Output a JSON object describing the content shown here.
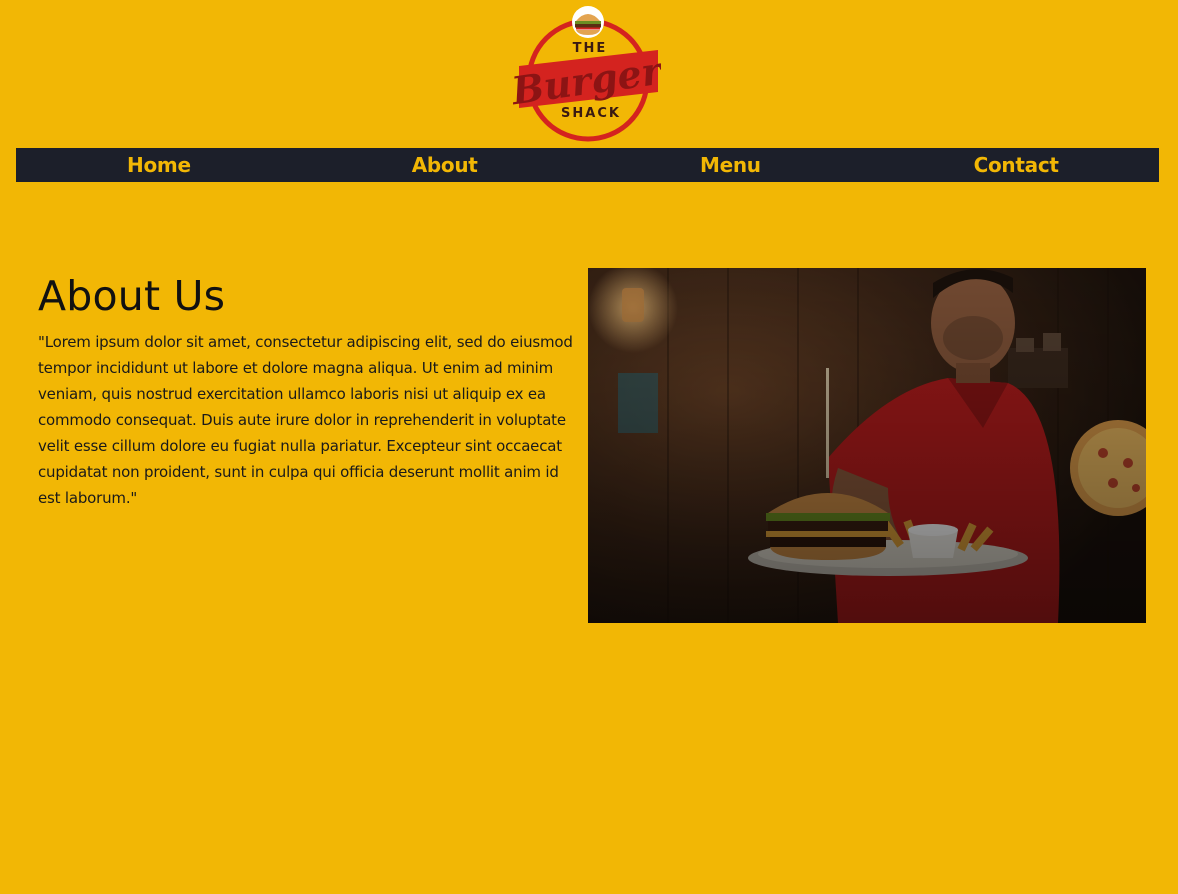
{
  "logo": {
    "line1": "THE",
    "line2": "Burger",
    "line3": "SHACK",
    "colors": {
      "ring": "#d4231f",
      "fill": "#f2b705",
      "text": "#3a1a12"
    }
  },
  "nav": {
    "items": [
      {
        "label": "Home"
      },
      {
        "label": "About"
      },
      {
        "label": "Menu"
      },
      {
        "label": "Contact"
      }
    ],
    "colors": {
      "background": "#1c1f2a",
      "text": "#f2b705"
    }
  },
  "about": {
    "heading": "About Us",
    "body": "\"Lorem ipsum dolor sit amet, consectetur adipiscing elit, sed do eiusmod tempor incididunt ut labore et dolore magna aliqua. Ut enim ad minim veniam, quis nostrud exercitation ullamco laboris nisi ut aliquip ex ea commodo consequat. Duis aute irure dolor in reprehenderit in voluptate velit esse cillum dolore eu fugiat nulla pariatur. Excepteur sint occaecat cupidatat non proident, sunt in culpa qui officia deserunt mollit anim id est laborum.\""
  },
  "photo": {
    "subject": "man in red shirt holding a burger platter"
  },
  "theme": {
    "background": "#f2b705"
  }
}
